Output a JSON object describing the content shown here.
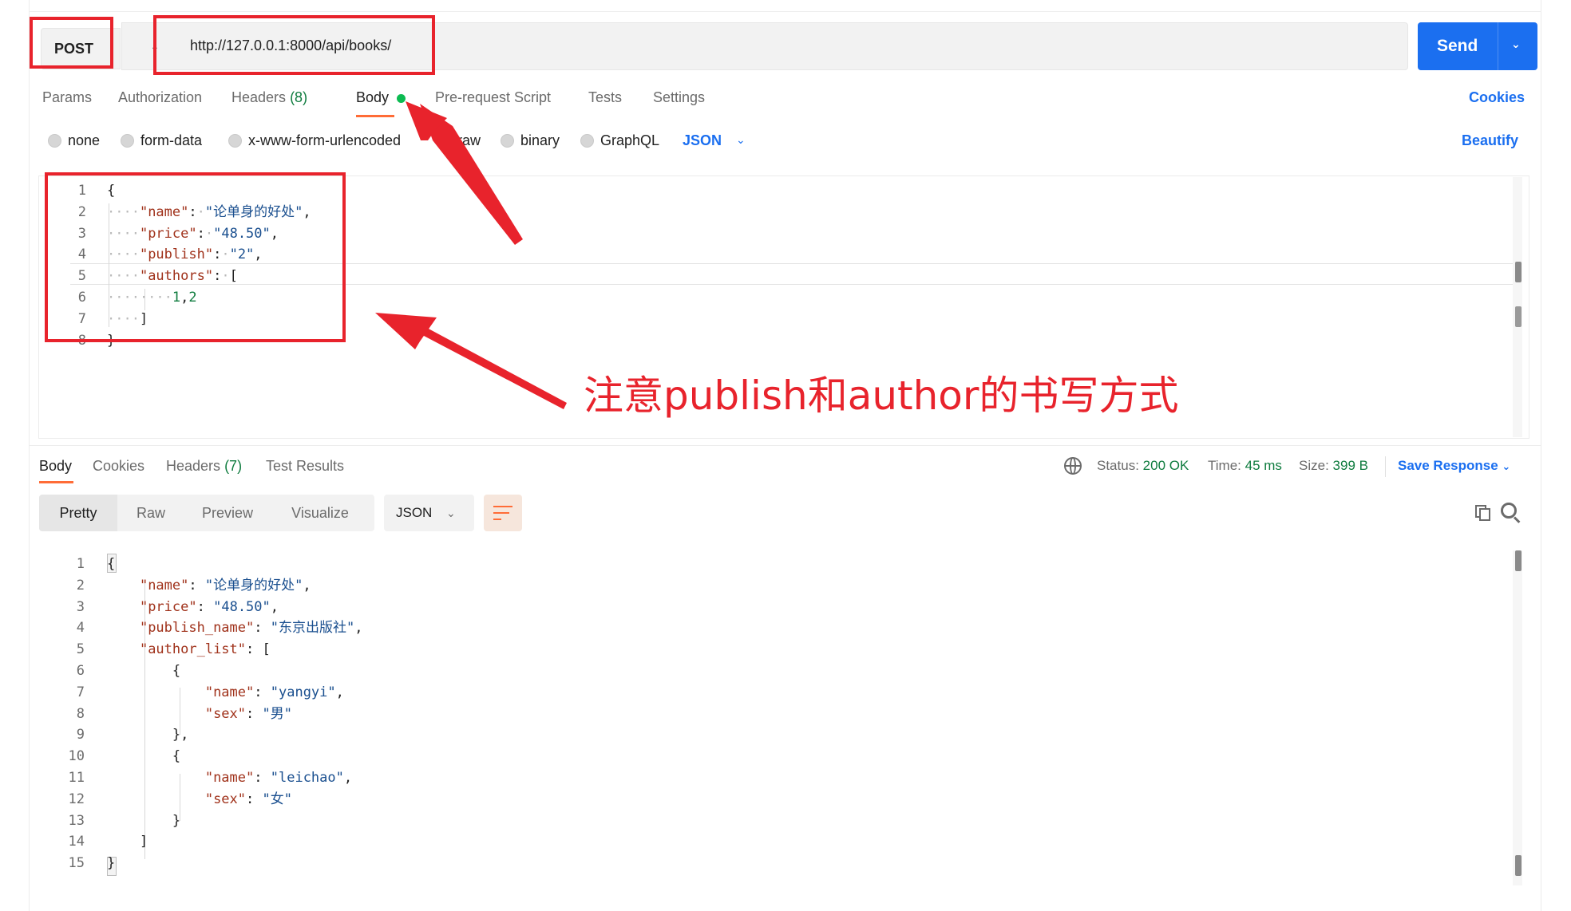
{
  "request": {
    "method": "POST",
    "url": "http://127.0.0.1:8000/api/books/",
    "send_label": "Send",
    "tabs": [
      {
        "label": "Params"
      },
      {
        "label": "Authorization"
      },
      {
        "label": "Headers",
        "count": "(8)"
      },
      {
        "label": "Body"
      },
      {
        "label": "Pre-request Script"
      },
      {
        "label": "Tests"
      },
      {
        "label": "Settings"
      }
    ],
    "cookies_label": "Cookies",
    "body_types": [
      "none",
      "form-data",
      "x-www-form-urlencoded",
      "raw",
      "binary",
      "GraphQL"
    ],
    "selected_body_type": "raw",
    "format": "JSON",
    "beautify_label": "Beautify",
    "line_numbers": [
      "1",
      "2",
      "3",
      "4",
      "5",
      "6",
      "7",
      "8"
    ]
  },
  "response": {
    "tabs": [
      {
        "label": "Body"
      },
      {
        "label": "Cookies"
      },
      {
        "label": "Headers",
        "count": "(7)"
      },
      {
        "label": "Test Results"
      }
    ],
    "status_label": "Status:",
    "status_value": "200 OK",
    "time_label": "Time:",
    "time_value": "45 ms",
    "size_label": "Size:",
    "size_value": "399 B",
    "save_label": "Save Response",
    "views": [
      "Pretty",
      "Raw",
      "Preview",
      "Visualize"
    ],
    "format": "JSON",
    "line_numbers": [
      "1",
      "2",
      "3",
      "4",
      "5",
      "6",
      "7",
      "8",
      "9",
      "10",
      "11",
      "12",
      "13",
      "14",
      "15"
    ]
  },
  "annotation": {
    "text": "注意publish和author的书写方式",
    "color": "#e8232c"
  },
  "colors": {
    "accent_orange": "#ff6c37",
    "send_blue": "#1b6ff0",
    "status_green": "#0f7c3f"
  }
}
